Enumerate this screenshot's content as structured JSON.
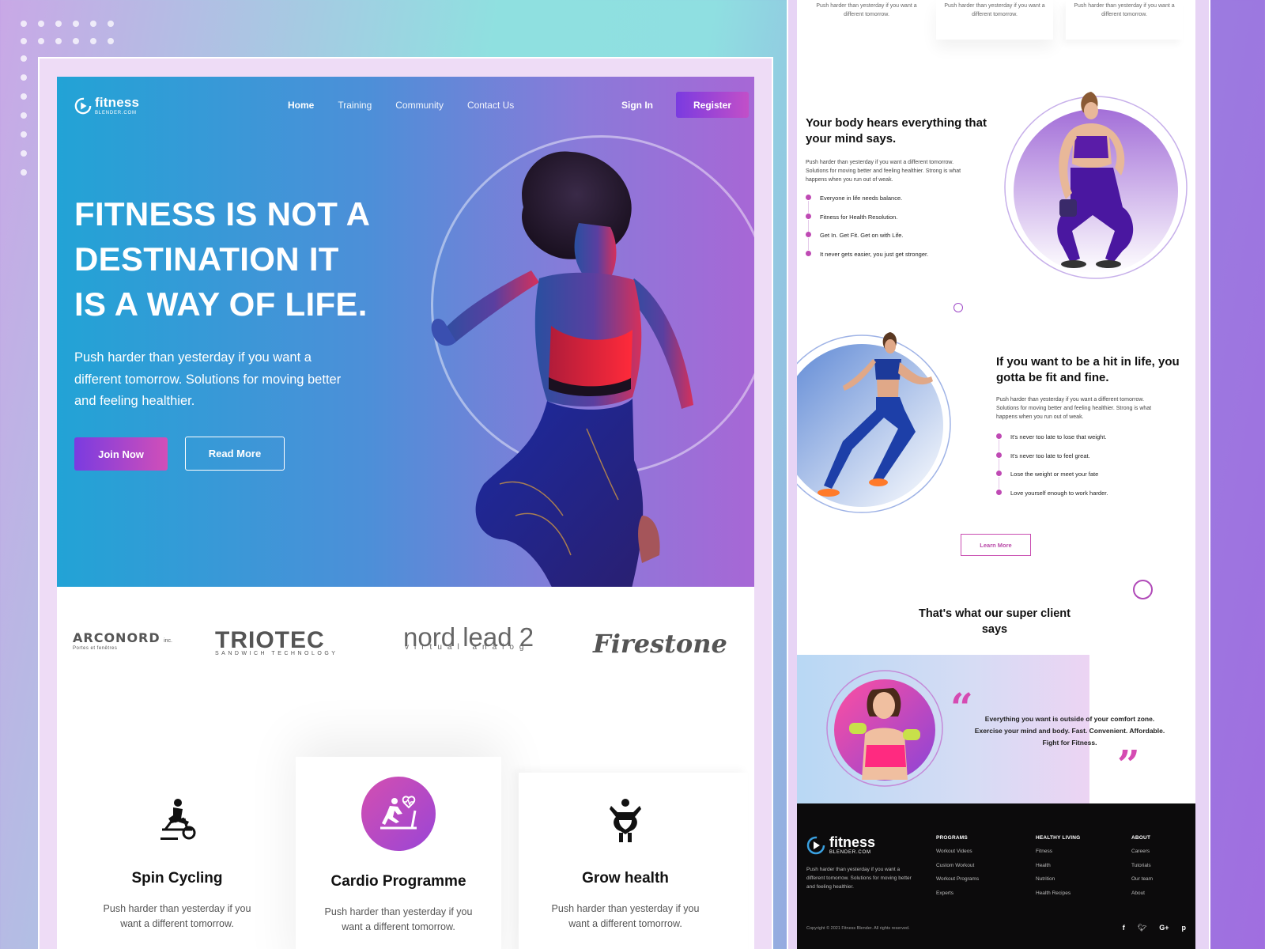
{
  "brand": {
    "name": "fitness",
    "sub": "BLENDER.COM"
  },
  "nav": {
    "items": [
      {
        "label": "Home"
      },
      {
        "label": "Training"
      },
      {
        "label": "Community"
      },
      {
        "label": "Contact Us"
      }
    ],
    "sign_in": "Sign In",
    "register": "Register"
  },
  "hero": {
    "lines": [
      "FITNESS IS NOT A",
      "DESTINATION IT",
      "IS A WAY OF LIFE."
    ],
    "subtitle": "Push harder than yesterday if you want a different tomorrow. Solutions for moving better and feeling healthier.",
    "join": "Join Now",
    "read": "Read More"
  },
  "partners": [
    {
      "name": "ARCONORD",
      "suffix": "inc.",
      "tag": "Portes et fenêtres"
    },
    {
      "name": "TRIOTEC",
      "tag": "SANDWICH TECHNOLOGY"
    },
    {
      "name": "nord lead 2",
      "tag": "virtual analog"
    },
    {
      "name": "Firestone"
    }
  ],
  "services": [
    {
      "title": "Spin Cycling",
      "text": "Push harder than yesterday if you want a different tomorrow.",
      "icon": "spin-bike-icon"
    },
    {
      "title": "Cardio Programme",
      "text": "Push harder than yesterday if you want a different tomorrow.",
      "icon": "treadmill-heart-icon"
    },
    {
      "title": "Grow health",
      "text": "Push harder than yesterday if you want a different tomorrow.",
      "icon": "body-health-icon"
    }
  ],
  "right": {
    "top_cards": [
      "Push harder than yesterday if you want a different tomorrow.",
      "Push harder than yesterday if you want a different tomorrow.",
      "Push harder than yesterday if you want a different tomorrow."
    ],
    "s1": {
      "title": "Your body hears everything that your mind says.",
      "body": "Push harder than yesterday if you want a different tomorrow. Solutions for  moving  better  and feeling  healthier. Strong is what happens when you run out of weak.",
      "items": [
        "Everyone in life needs balance.",
        "Fitness for Health Resolution.",
        "Get In. Get Fit. Get on with Life.",
        "It never gets easier, you just get stronger."
      ]
    },
    "s2": {
      "title": "If you want to be a hit in life, you gotta be fit and fine.",
      "body": "Push harder than yesterday if you want a different tomorrow. Solutions for  moving  better  and feeling  healthier. Strong is what happens when you run out of weak.",
      "items": [
        "It's never too late to lose that weight.",
        "It's never too late to feel great.",
        "Lose the weight or meet your fate",
        "Love yourself enough to work harder."
      ],
      "cta": "Learn More"
    },
    "testimonial": {
      "title": "That's what our super client says",
      "quote": "Everything you want is outside of your comfort zone. Exercise your mind and body. Fast. Convenient. Affordable. Fight for Fitness."
    },
    "footer": {
      "about": "Push harder than yesterday if you want a different tomorrow. Solutions for moving better  and feeling  healthier.",
      "columns": [
        {
          "title": "PROGRAMS",
          "links": [
            "Workout Videos",
            "Custom Workout",
            "Workout Programs",
            "Experts"
          ]
        },
        {
          "title": "HEALTHY LIVING",
          "links": [
            "Fitness",
            "Health",
            "Nutrition",
            "Health Recipes"
          ]
        },
        {
          "title": "ABOUT",
          "links": [
            "Careers",
            "Tutorials",
            "Our team",
            "About"
          ]
        }
      ],
      "copyright": "Copyright © 2021 Fitness Blender. All rights reserved.",
      "social": [
        "f",
        "t",
        "G+",
        "p"
      ]
    }
  },
  "colors": {
    "accent_purple": "#7a3be0",
    "accent_pink": "#d14fb8",
    "hero_blue": "#22a3d6",
    "footer_bg": "#0c0b0c"
  }
}
